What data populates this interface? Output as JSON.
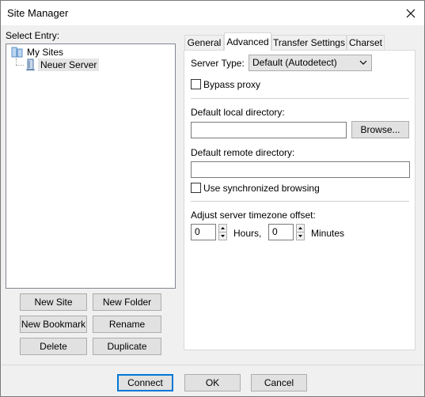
{
  "window": {
    "title": "Site Manager"
  },
  "left": {
    "select_entry_label": "Select Entry:",
    "tree": {
      "root_label": "My Sites",
      "child_label": "Neuer Server"
    },
    "buttons": {
      "new_site": "New Site",
      "new_folder": "New Folder",
      "new_bookmark": "New Bookmark",
      "rename": "Rename",
      "delete": "Delete",
      "duplicate": "Duplicate"
    }
  },
  "tabs": [
    {
      "label": "General",
      "active": false
    },
    {
      "label": "Advanced",
      "active": true
    },
    {
      "label": "Transfer Settings",
      "active": false
    },
    {
      "label": "Charset",
      "active": false
    }
  ],
  "advanced": {
    "server_type_label": "Server Type:",
    "server_type_value": "Default (Autodetect)",
    "bypass_proxy_label": "Bypass proxy",
    "bypass_proxy_checked": false,
    "default_local_dir_label": "Default local directory:",
    "default_local_dir_value": "",
    "browse_label": "Browse...",
    "default_remote_dir_label": "Default remote directory:",
    "default_remote_dir_value": "",
    "sync_browsing_label": "Use synchronized browsing",
    "sync_browsing_checked": false,
    "timezone_label": "Adjust server timezone offset:",
    "hours_value": "0",
    "hours_label": "Hours,",
    "minutes_value": "0",
    "minutes_label": "Minutes"
  },
  "footer": {
    "connect": "Connect",
    "ok": "OK",
    "cancel": "Cancel"
  }
}
